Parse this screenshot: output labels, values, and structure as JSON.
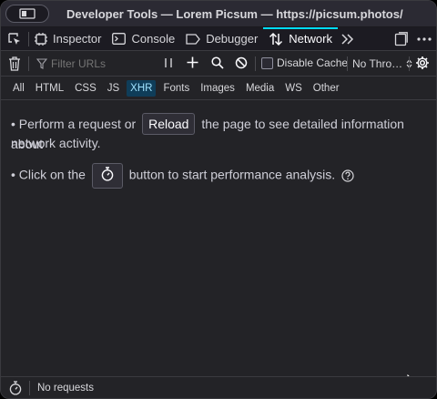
{
  "window": {
    "title": "Developer Tools — Lorem Picsum — https://picsum.photos/"
  },
  "tabs": [
    {
      "label": "Inspector",
      "icon": "inspector-icon"
    },
    {
      "label": "Console",
      "icon": "console-icon"
    },
    {
      "label": "Debugger",
      "icon": "debugger-icon"
    },
    {
      "label": "Network",
      "icon": "network-icon",
      "selected": true
    }
  ],
  "toolbar": {
    "filter_placeholder": "Filter URLs",
    "disable_cache_label": "Disable Cache",
    "throttle_value": "No Thro…"
  },
  "filters": [
    "All",
    "HTML",
    "CSS",
    "JS",
    "XHR",
    "Fonts",
    "Images",
    "Media",
    "WS",
    "Other"
  ],
  "active_filter": "XHR",
  "content": {
    "line1_prefix": "Perform a request or",
    "reload_label": "Reload",
    "line1_suffix": "the page to see detailed information about",
    "line1_cont": "network activity.",
    "line2_prefix": "Click on the",
    "line2_suffix": "button to start performance analysis."
  },
  "status": {
    "text": "No requests"
  },
  "colors": {
    "accent": "#00ddff",
    "background": "#232327",
    "active_filter_bg": "#0f3d59"
  }
}
